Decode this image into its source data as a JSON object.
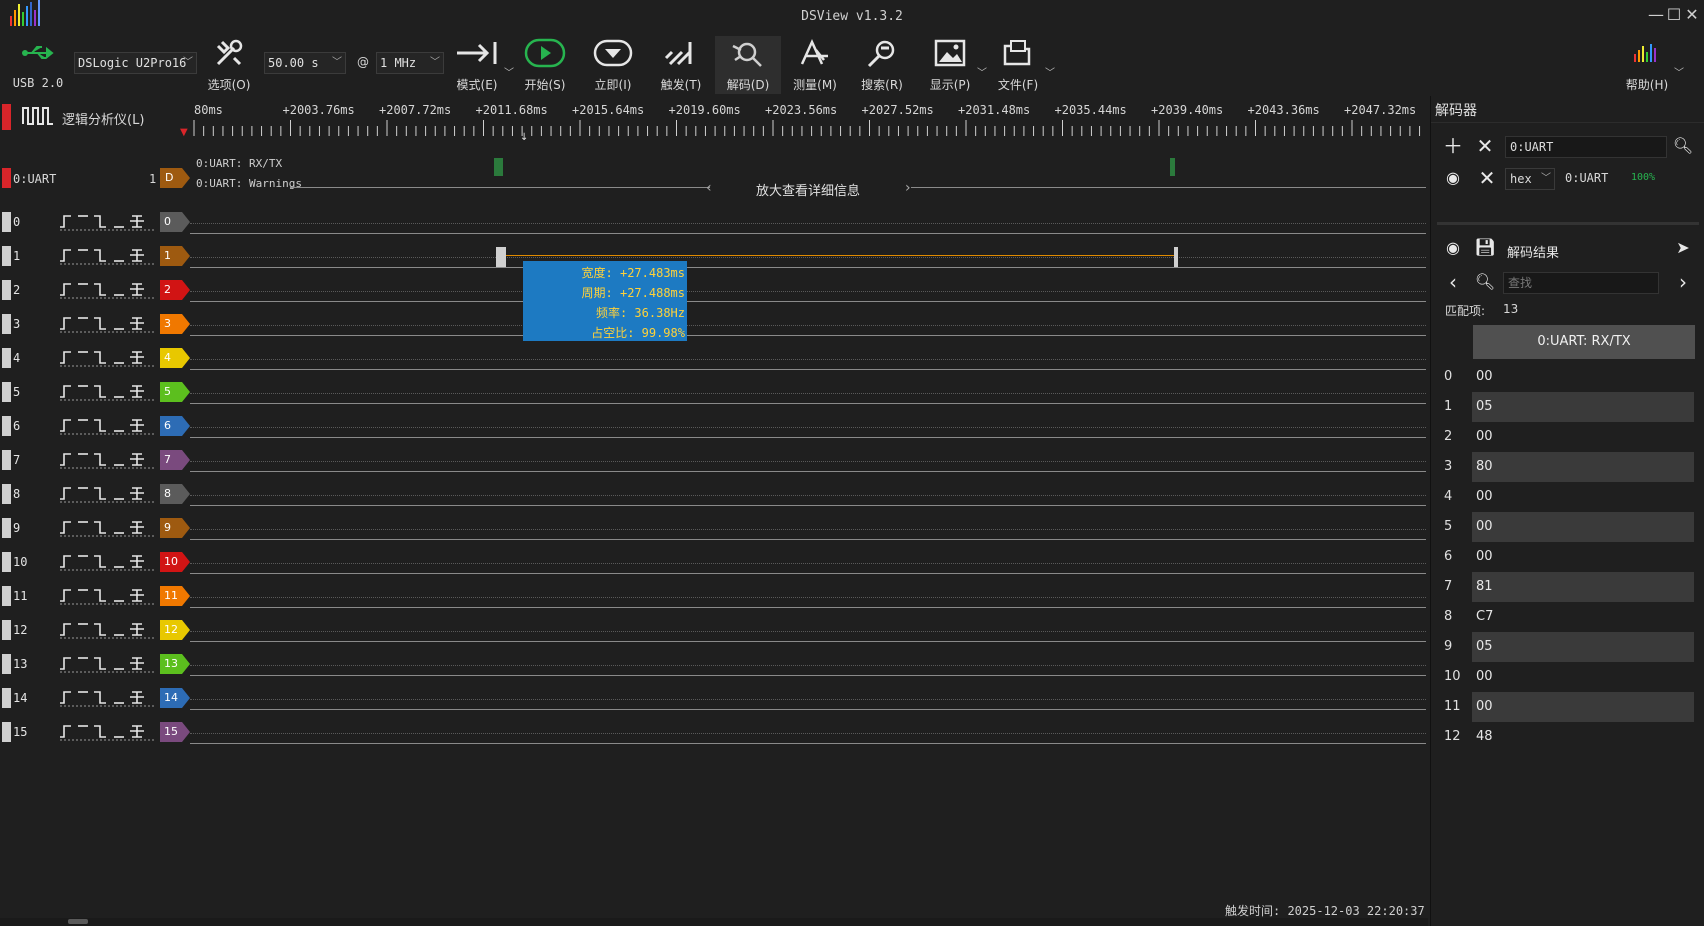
{
  "app": {
    "title": "DSView v1.3.2"
  },
  "window": {
    "minimize": "—",
    "maximize": "☐",
    "close": "✕"
  },
  "toolbar": {
    "usb_label": "USB 2.0",
    "device": "DSLogic U2Pro16",
    "duration": "50.00 s",
    "at": "@",
    "rate": "1 MHz",
    "options": "选项(O)",
    "mode": "模式(E)",
    "start": "开始(S)",
    "instant": "立即(I)",
    "trigger": "触发(T)",
    "decode": "解码(D)",
    "measure": "测量(M)",
    "search": "搜索(R)",
    "display": "显示(P)",
    "file": "文件(F)",
    "help": "帮助(H)"
  },
  "colors": {
    "accent_green": "#27b44f",
    "tooltip_bg": "#1d7ac2",
    "tooltip_text": "#ffd23a"
  },
  "ruler": {
    "group_label": "逻辑分析仪(L)",
    "ticks": [
      "80ms",
      "+2003.76ms",
      "+2007.72ms",
      "+2011.68ms",
      "+2015.64ms",
      "+2019.60ms",
      "+2023.56ms",
      "+2027.52ms",
      "+2031.48ms",
      "+2035.44ms",
      "+2039.40ms",
      "+2043.36ms",
      "+2047.32ms"
    ]
  },
  "decoder_track": {
    "name": "0:UART",
    "count": "1",
    "tag": "D",
    "line1": "0:UART: RX/TX",
    "line2": "0:UART: Warnings",
    "zoom_hint": "放大查看详细信息"
  },
  "channels": [
    {
      "num": "0",
      "tag": "0",
      "color": "#5b5b5b"
    },
    {
      "num": "1",
      "tag": "1",
      "color": "#9e5a10"
    },
    {
      "num": "2",
      "tag": "2",
      "color": "#d11414"
    },
    {
      "num": "3",
      "tag": "3",
      "color": "#f07800"
    },
    {
      "num": "4",
      "tag": "4",
      "color": "#e8c800"
    },
    {
      "num": "5",
      "tag": "5",
      "color": "#5cbf1e"
    },
    {
      "num": "6",
      "tag": "6",
      "color": "#2d6cb5"
    },
    {
      "num": "7",
      "tag": "7",
      "color": "#7a4a7e"
    },
    {
      "num": "8",
      "tag": "8",
      "color": "#5b5b5b"
    },
    {
      "num": "9",
      "tag": "9",
      "color": "#9e5a10"
    },
    {
      "num": "10",
      "tag": "10",
      "color": "#d11414"
    },
    {
      "num": "11",
      "tag": "11",
      "color": "#f07800"
    },
    {
      "num": "12",
      "tag": "12",
      "color": "#e8c800"
    },
    {
      "num": "13",
      "tag": "13",
      "color": "#5cbf1e"
    },
    {
      "num": "14",
      "tag": "14",
      "color": "#2d6cb5"
    },
    {
      "num": "15",
      "tag": "15",
      "color": "#7a4a7e"
    }
  ],
  "measure": {
    "width": "宽度: +27.483ms",
    "period": "周期: +27.488ms",
    "freq": "频率: 36.38Hz",
    "duty": "占空比: 99.98%"
  },
  "decoder_panel": {
    "title": "解码器",
    "decoder_input": "0:UART",
    "format": "hex",
    "decoder_name": "0:UART",
    "progress": "100%",
    "results_title": "解码结果",
    "search_placeholder": "查找",
    "match_label": "匹配项:",
    "match_count": "13",
    "column_header": "0:UART: RX/TX",
    "rows": [
      {
        "idx": "0",
        "val": "00"
      },
      {
        "idx": "1",
        "val": "05"
      },
      {
        "idx": "2",
        "val": "00"
      },
      {
        "idx": "3",
        "val": "80"
      },
      {
        "idx": "4",
        "val": "00"
      },
      {
        "idx": "5",
        "val": "00"
      },
      {
        "idx": "6",
        "val": "00"
      },
      {
        "idx": "7",
        "val": "81"
      },
      {
        "idx": "8",
        "val": "C7"
      },
      {
        "idx": "9",
        "val": "05"
      },
      {
        "idx": "10",
        "val": "00"
      },
      {
        "idx": "11",
        "val": "00"
      },
      {
        "idx": "12",
        "val": "48"
      }
    ]
  },
  "status": {
    "trigger_time": "触发时间: 2025-12-03 22:20:37"
  }
}
